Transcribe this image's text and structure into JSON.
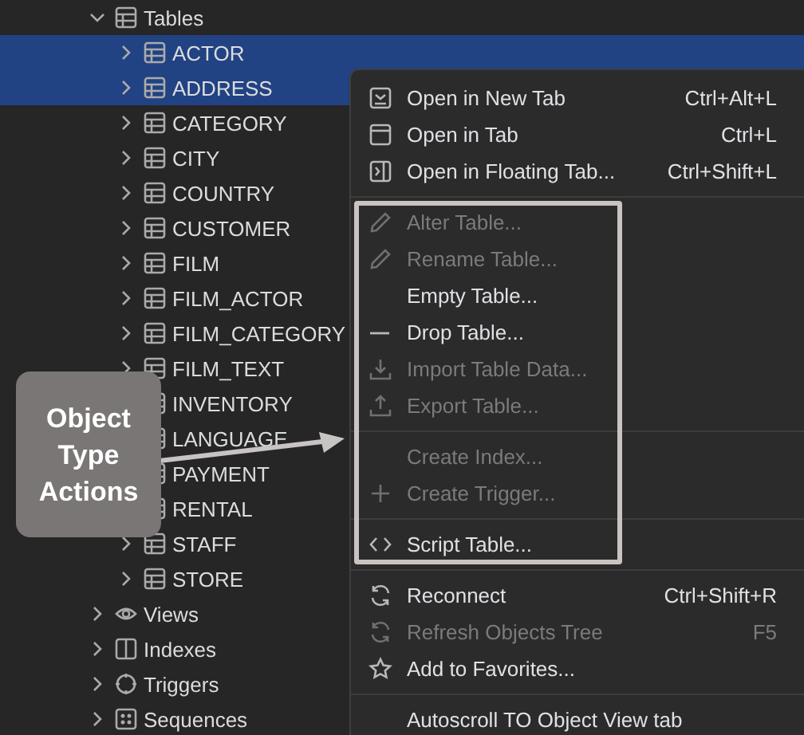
{
  "tree": [
    {
      "label": "Tables",
      "expanded": true,
      "children": [
        {
          "label": "ACTOR",
          "selected": true,
          "expanded": false
        },
        {
          "label": "ADDRESS",
          "selected": true,
          "expanded": false
        },
        {
          "label": "CATEGORY",
          "selected": false,
          "expanded": false
        },
        {
          "label": "CITY",
          "selected": false,
          "expanded": false
        },
        {
          "label": "COUNTRY",
          "selected": false,
          "expanded": false
        },
        {
          "label": "CUSTOMER",
          "selected": false,
          "expanded": false
        },
        {
          "label": "FILM",
          "selected": false,
          "expanded": false
        },
        {
          "label": "FILM_ACTOR",
          "selected": false,
          "expanded": false
        },
        {
          "label": "FILM_CATEGORY",
          "selected": false,
          "expanded": false
        },
        {
          "label": "FILM_TEXT",
          "selected": false,
          "expanded": false
        },
        {
          "label": "INVENTORY",
          "selected": false
        },
        {
          "label": "LANGUAGE",
          "selected": false
        },
        {
          "label": "PAYMENT",
          "selected": false
        },
        {
          "label": "RENTAL",
          "selected": false
        },
        {
          "label": "STAFF",
          "selected": false,
          "expanded": false
        },
        {
          "label": "STORE",
          "selected": false,
          "expanded": false
        }
      ]
    },
    {
      "label": "Views",
      "expanded": false
    },
    {
      "label": "Indexes",
      "expanded": false
    },
    {
      "label": "Triggers",
      "expanded": false
    },
    {
      "label": "Sequences",
      "expanded": false
    }
  ],
  "context_menu": {
    "groups": [
      {
        "framed": false,
        "sections": [
          [
            {
              "label": "Open in New Tab",
              "shortcut": "Ctrl+Alt+L",
              "disabled": false
            },
            {
              "label": "Open in Tab",
              "shortcut": "Ctrl+L",
              "disabled": false
            },
            {
              "label": "Open in Floating Tab...",
              "shortcut": "Ctrl+Shift+L",
              "disabled": false
            }
          ]
        ]
      },
      {
        "framed": true,
        "sections": [
          [
            {
              "label": "Alter Table...",
              "disabled": true
            },
            {
              "label": "Rename Table...",
              "disabled": true
            },
            {
              "label": "Empty Table...",
              "disabled": false
            },
            {
              "label": "Drop Table...",
              "disabled": false
            },
            {
              "label": "Import Table Data...",
              "disabled": true
            },
            {
              "label": "Export Table...",
              "disabled": true
            }
          ],
          [
            {
              "label": "Create Index...",
              "disabled": true
            },
            {
              "label": "Create Trigger...",
              "disabled": true
            }
          ],
          [
            {
              "label": "Script Table...",
              "disabled": false
            }
          ]
        ]
      },
      {
        "framed": false,
        "sections": [
          [
            {
              "label": "Reconnect",
              "shortcut": "Ctrl+Shift+R",
              "disabled": false
            },
            {
              "label": "Refresh Objects Tree",
              "shortcut": "F5",
              "disabled": true
            },
            {
              "label": "Add to Favorites...",
              "disabled": false
            }
          ],
          [
            {
              "label": "Autoscroll TO Object View tab",
              "disabled": false
            }
          ]
        ]
      }
    ]
  },
  "callout": {
    "text": "Object Type Actions"
  }
}
